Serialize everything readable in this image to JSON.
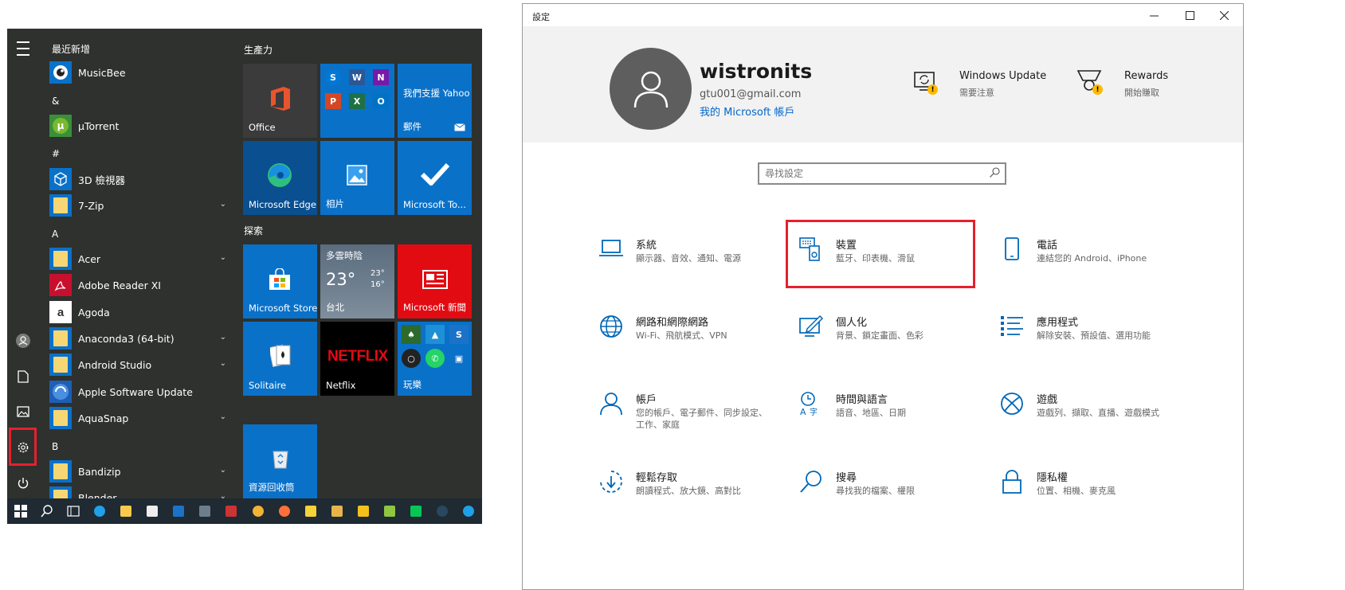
{
  "start_menu": {
    "groups": [
      "最近新增",
      "&",
      "#",
      "A",
      "B"
    ],
    "apps": [
      {
        "name": "MusicBee",
        "icon": "musicbee-icon",
        "expand": false
      },
      {
        "name": "µTorrent",
        "icon": "utorrent-icon",
        "expand": false
      },
      {
        "name": "3D 檢視器",
        "icon": "3d-viewer-icon",
        "expand": false
      },
      {
        "name": "7-Zip",
        "icon": "folder-icon",
        "expand": true
      },
      {
        "name": "Acer",
        "icon": "folder-icon",
        "expand": true
      },
      {
        "name": "Adobe Reader XI",
        "icon": "adobe-reader-icon",
        "expand": false
      },
      {
        "name": "Agoda",
        "icon": "agoda-icon",
        "expand": false
      },
      {
        "name": "Anaconda3 (64-bit)",
        "icon": "folder-icon",
        "expand": true
      },
      {
        "name": "Android Studio",
        "icon": "folder-icon",
        "expand": true
      },
      {
        "name": "Apple Software Update",
        "icon": "apple-update-icon",
        "expand": false
      },
      {
        "name": "AquaSnap",
        "icon": "folder-icon",
        "expand": true
      },
      {
        "name": "Bandizip",
        "icon": "folder-icon",
        "expand": true
      },
      {
        "name": "Blender",
        "icon": "folder-icon",
        "expand": true
      }
    ],
    "sections": {
      "productivity": "生產力",
      "explore": "探索"
    },
    "tiles": {
      "office": "Office",
      "yahoo_top": "我們支援 Yahoo",
      "yahoo_bottom": "郵件",
      "edge": "Microsoft Edge",
      "photos": "相片",
      "todo": "Microsoft To...",
      "weather_title": "多雲時陰",
      "weather_temp": "23°",
      "weather_high": "23°",
      "weather_low": "16°",
      "weather_city": "台北",
      "store": "Microsoft Store",
      "news": "Microsoft 新聞",
      "solitaire": "Solitaire",
      "netflix_logo": "NETFLIX",
      "netflix": "Netflix",
      "play": "玩樂",
      "recycle": "資源回收筒"
    }
  },
  "settings": {
    "window_title": "設定",
    "user": {
      "name": "wistronits",
      "email": "gtu001@gmail.com",
      "account_link": "我的 Microsoft 帳戶"
    },
    "header_items": [
      {
        "title": "Windows Update",
        "subtitle": "需要注意"
      },
      {
        "title": "Rewards",
        "subtitle": "開始賺取"
      }
    ],
    "search_placeholder": "尋找設定",
    "categories": [
      {
        "title": "系統",
        "subtitle": "顯示器、音效、通知、電源",
        "icon": "laptop-icon"
      },
      {
        "title": "裝置",
        "subtitle": "藍牙、印表機、滑鼠",
        "icon": "devices-icon"
      },
      {
        "title": "電話",
        "subtitle": "連結您的 Android、iPhone",
        "icon": "phone-icon"
      },
      {
        "title": "網路和網際網路",
        "subtitle": "Wi-Fi、飛航模式、VPN",
        "icon": "globe-icon"
      },
      {
        "title": "個人化",
        "subtitle": "背景、鎖定畫面、色彩",
        "icon": "personalize-icon"
      },
      {
        "title": "應用程式",
        "subtitle": "解除安裝、預設值、選用功能",
        "icon": "apps-icon"
      },
      {
        "title": "帳戶",
        "subtitle": "您的帳戶、電子郵件、同步設定、工作、家庭",
        "icon": "account-icon"
      },
      {
        "title": "時間與語言",
        "subtitle": "語音、地區、日期",
        "icon": "time-language-icon"
      },
      {
        "title": "遊戲",
        "subtitle": "遊戲列、擷取、直播、遊戲模式",
        "icon": "xbox-icon"
      },
      {
        "title": "輕鬆存取",
        "subtitle": "朗讀程式、放大鏡、高對比",
        "icon": "ease-of-access-icon"
      },
      {
        "title": "搜尋",
        "subtitle": "尋找我的檔案、權限",
        "icon": "search-icon"
      },
      {
        "title": "隱私權",
        "subtitle": "位置、相機、麥克風",
        "icon": "lock-icon"
      }
    ]
  },
  "colors": {
    "accent": "#0078d7",
    "highlight": "#e5202e",
    "start_bg": "#2e312e",
    "taskbar": "#1f2a33"
  }
}
